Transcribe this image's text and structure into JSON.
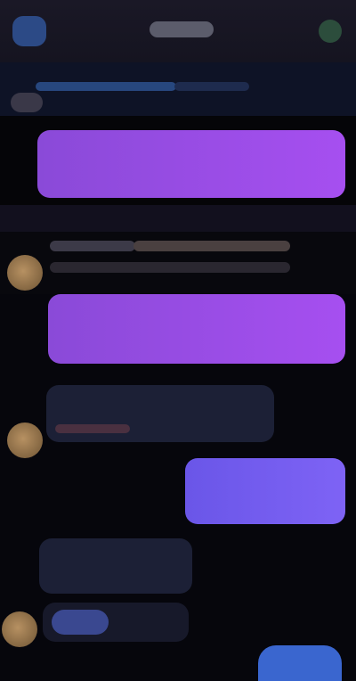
{
  "header": {
    "back_label": "",
    "title": "",
    "status": ""
  },
  "banner": {
    "text": "",
    "subtext": ""
  },
  "messages": [
    {
      "id": "m1",
      "side": "outgoing",
      "text": ""
    },
    {
      "id": "m2",
      "side": "incoming",
      "sender": "",
      "text": ""
    },
    {
      "id": "m3",
      "side": "outgoing",
      "text": ""
    },
    {
      "id": "m4",
      "side": "incoming",
      "sender": "",
      "text": ""
    },
    {
      "id": "m5",
      "side": "outgoing",
      "text": ""
    },
    {
      "id": "m6",
      "side": "incoming",
      "text": ""
    },
    {
      "id": "m7",
      "side": "incoming",
      "text": ""
    }
  ],
  "composer": {
    "send_label": ""
  },
  "colors": {
    "header_bg": "#1a1826",
    "banner_bg": "#0e1326",
    "page_bg": "#06060c",
    "outgoing_bubble": "#9a4ce6",
    "outgoing_bubble_alt": "#7460ee",
    "incoming_bubble": "#1c2036",
    "accent_blue": "#3a66cf"
  },
  "icons": {
    "back": "chevron-left-icon",
    "status": "presence-dot-icon"
  }
}
